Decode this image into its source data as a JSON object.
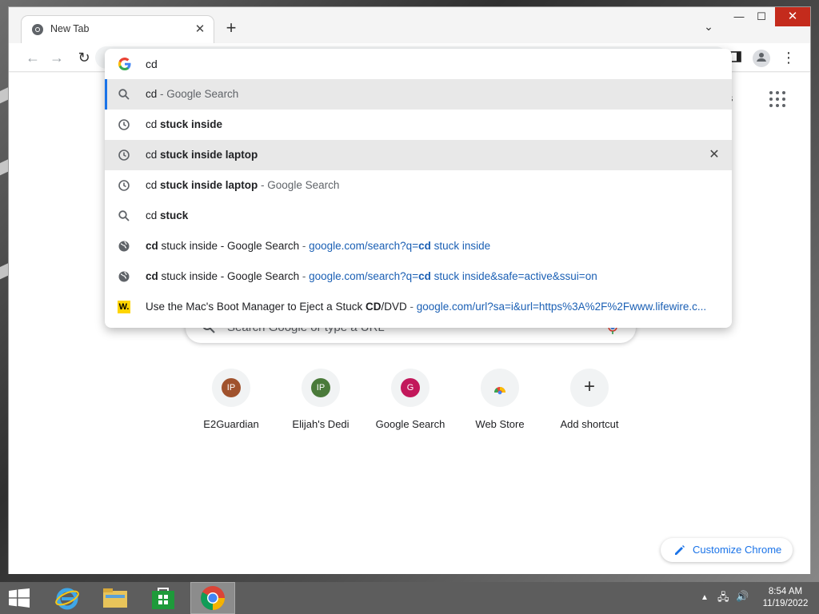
{
  "browser": {
    "tab": {
      "title": "New Tab"
    },
    "window_controls": {
      "minimize": "—",
      "maximize": "☐",
      "close": "✕"
    }
  },
  "omnibox": {
    "typed": "cd",
    "suggestions": [
      {
        "icon": "search-icon",
        "parts": [
          {
            "t": "cd",
            "style": "normal"
          },
          {
            "t": " - Google Search",
            "style": "dim"
          }
        ]
      },
      {
        "icon": "history-icon",
        "parts": [
          {
            "t": "cd ",
            "style": "normal"
          },
          {
            "t": "stuck inside",
            "style": "bold"
          }
        ]
      },
      {
        "icon": "history-icon",
        "parts": [
          {
            "t": "cd ",
            "style": "normal"
          },
          {
            "t": "stuck inside laptop",
            "style": "bold"
          }
        ],
        "removable": true
      },
      {
        "icon": "history-icon",
        "parts": [
          {
            "t": "cd ",
            "style": "normal"
          },
          {
            "t": "stuck inside laptop",
            "style": "bold"
          },
          {
            "t": " - Google Search",
            "style": "dim"
          }
        ]
      },
      {
        "icon": "search-icon",
        "parts": [
          {
            "t": "cd ",
            "style": "normal"
          },
          {
            "t": "stuck",
            "style": "bold"
          }
        ]
      },
      {
        "icon": "globe-icon",
        "parts": [
          {
            "t": "cd",
            "style": "bold"
          },
          {
            "t": " stuck inside - Google Search",
            "style": "normal"
          },
          {
            "t": " - ",
            "style": "dim"
          },
          {
            "t": "google.com/search?q=",
            "style": "url"
          },
          {
            "t": "cd",
            "style": "urlbold"
          },
          {
            "t": " stuck inside",
            "style": "url"
          }
        ]
      },
      {
        "icon": "globe-icon",
        "parts": [
          {
            "t": "cd",
            "style": "bold"
          },
          {
            "t": " stuck inside - Google Search",
            "style": "normal"
          },
          {
            "t": " - ",
            "style": "dim"
          },
          {
            "t": "google.com/search?q=",
            "style": "url"
          },
          {
            "t": "cd",
            "style": "urlbold"
          },
          {
            "t": " stuck inside&safe=active&ssui=on",
            "style": "url"
          }
        ]
      },
      {
        "icon": "lifewire-icon",
        "parts": [
          {
            "t": "Use the Mac's Boot Manager to Eject a Stuck ",
            "style": "normal"
          },
          {
            "t": "CD",
            "style": "bold"
          },
          {
            "t": "/DVD",
            "style": "normal"
          },
          {
            "t": " - ",
            "style": "dim"
          },
          {
            "t": "google.com/url?sa=i&url=https%3A%2F%2Fwww.lifewire.c...",
            "style": "url"
          }
        ]
      }
    ]
  },
  "newtab": {
    "images_link": "nages",
    "search_placeholder": "Search Google or type a URL",
    "shortcuts": [
      {
        "label": "E2Guardian",
        "initials": "IP",
        "color": "#a0522d"
      },
      {
        "label": "Elijah's Dedi",
        "initials": "IP",
        "color": "#4a7a3a"
      },
      {
        "label": "Google Search",
        "initials": "G",
        "color": "#c2185b"
      },
      {
        "label": "Web Store",
        "initials": "",
        "color": ""
      },
      {
        "label": "Add shortcut",
        "initials": "+",
        "color": ""
      }
    ],
    "customize_label": "Customize Chrome"
  },
  "taskbar": {
    "time": "8:54 AM",
    "date": "11/19/2022"
  }
}
